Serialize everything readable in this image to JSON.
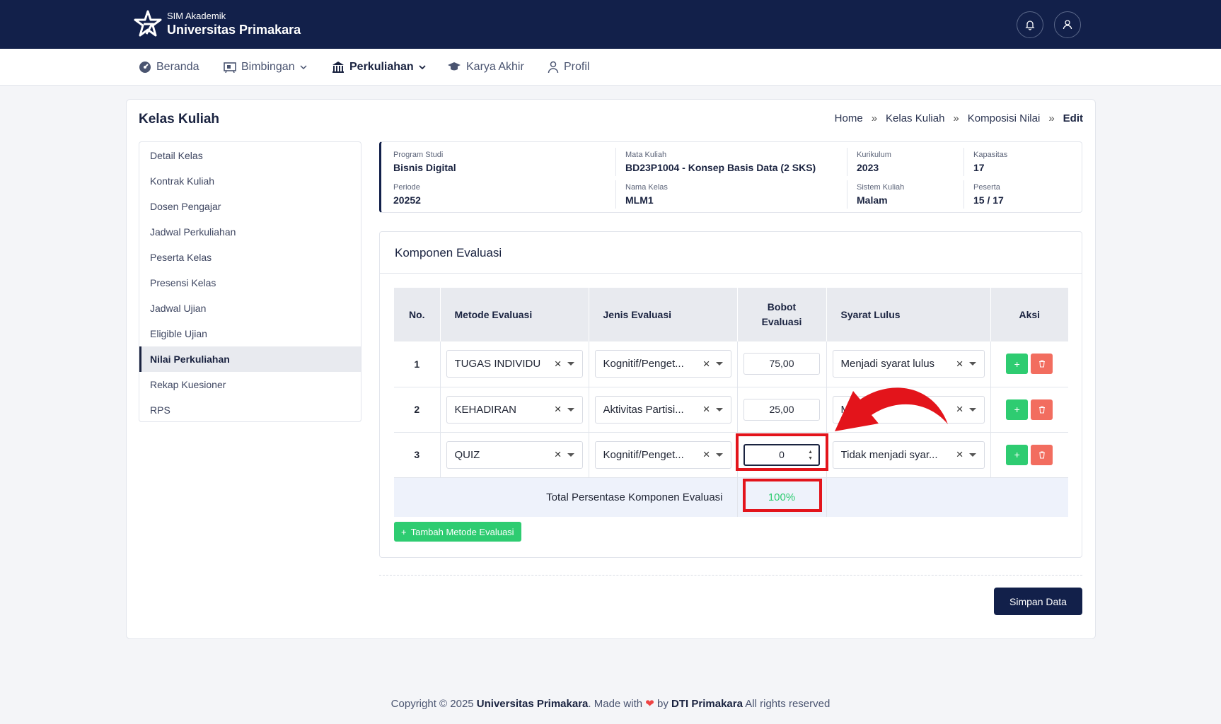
{
  "header": {
    "subtitle": "SIM Akademik",
    "title": "Universitas Primakara"
  },
  "nav": [
    {
      "label": "Beranda",
      "icon": "dashboard-icon"
    },
    {
      "label": "Bimbingan",
      "icon": "board-icon",
      "dropdown": true
    },
    {
      "label": "Perkuliahan",
      "icon": "building-icon",
      "dropdown": true,
      "active": true
    },
    {
      "label": "Karya Akhir",
      "icon": "graduation-cap-icon"
    },
    {
      "label": "Profil",
      "icon": "user-icon"
    }
  ],
  "page": {
    "title": "Kelas Kuliah",
    "breadcrumb": [
      "Home",
      "Kelas Kuliah",
      "Komposisi Nilai",
      "Edit"
    ],
    "breadcrumb_sep": "»"
  },
  "sidebar": [
    "Detail Kelas",
    "Kontrak Kuliah",
    "Dosen Pengajar",
    "Jadwal Perkuliahan",
    "Peserta Kelas",
    "Presensi Kelas",
    "Jadwal Ujian",
    "Eligible Ujian",
    "Nilai Perkuliahan",
    "Rekap Kuesioner",
    "RPS"
  ],
  "info": {
    "program_studi": {
      "label": "Program Studi",
      "value": "Bisnis Digital"
    },
    "mata_kuliah": {
      "label": "Mata Kuliah",
      "value": "BD23P1004 - Konsep Basis Data (2 SKS)"
    },
    "kurikulum": {
      "label": "Kurikulum",
      "value": "2023"
    },
    "kapasitas": {
      "label": "Kapasitas",
      "value": "17"
    },
    "periode": {
      "label": "Periode",
      "value": "20252"
    },
    "nama_kelas": {
      "label": "Nama Kelas",
      "value": "MLM1"
    },
    "sistem_kuliah": {
      "label": "Sistem Kuliah",
      "value": "Malam"
    },
    "peserta": {
      "label": "Peserta",
      "value": "15 / 17"
    }
  },
  "komponen": {
    "title": "Komponen Evaluasi",
    "headers": {
      "no": "No.",
      "metode": "Metode Evaluasi",
      "jenis": "Jenis Evaluasi",
      "bobot_1": "Bobot",
      "bobot_2": "Evaluasi",
      "syarat": "Syarat Lulus",
      "aksi": "Aksi"
    },
    "rows": [
      {
        "no": "1",
        "metode": "TUGAS INDIVIDU",
        "jenis": "Kognitif/Penget...",
        "bobot": "75,00",
        "syarat": "Menjadi syarat lulus"
      },
      {
        "no": "2",
        "metode": "KEHADIRAN",
        "jenis": "Aktivitas Partisi...",
        "bobot": "25,00",
        "syarat": "M"
      },
      {
        "no": "3",
        "metode": "QUIZ",
        "jenis": "Kognitif/Penget...",
        "bobot": "0",
        "syarat": "Tidak menjadi syar..."
      }
    ],
    "total_label": "Total Persentase Komponen Evaluasi",
    "total_value": "100%",
    "add_button": "Tambah Metode Evaluasi",
    "clear_glyph": "×",
    "add_glyph": "+"
  },
  "save_button": "Simpan Data",
  "footer": {
    "copyright": "Copyright © 2025",
    "org": "Universitas Primakara",
    "made_with": ". Made with",
    "by": "by",
    "dev": "DTI Primakara",
    "rights": "All rights reserved"
  },
  "colors": {
    "navy": "#12204a",
    "green": "#2ecc71",
    "red_highlight": "#e3141b",
    "delete": "#f26d5f"
  }
}
